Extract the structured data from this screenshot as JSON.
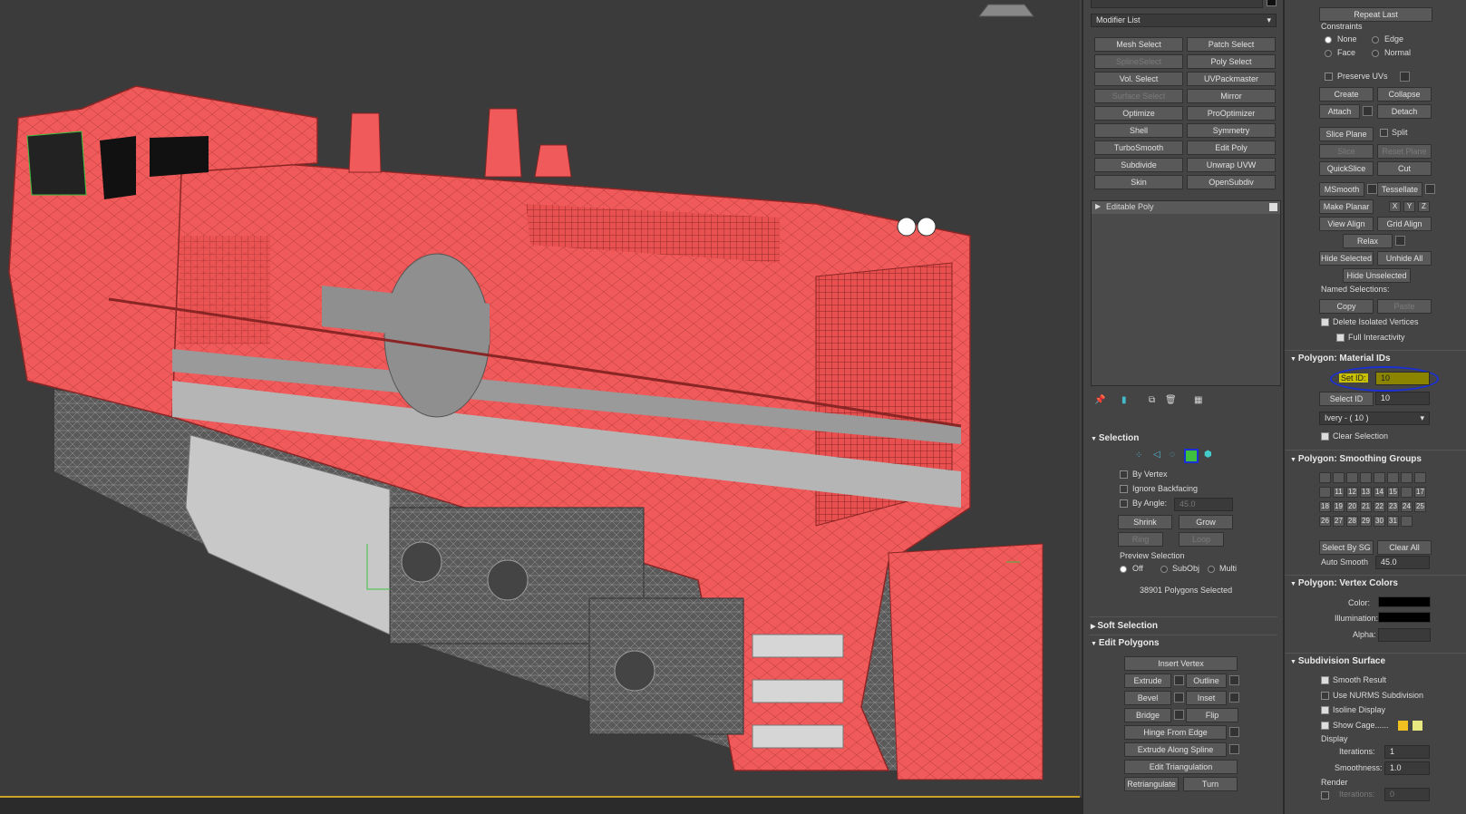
{
  "modifier_panel": {
    "object_name": "",
    "modifier_list": "Modifier List",
    "buttons": [
      {
        "label": "Mesh Select",
        "enabled": true
      },
      {
        "label": "Patch Select",
        "enabled": true
      },
      {
        "label": "SplineSelect",
        "enabled": false
      },
      {
        "label": "Poly Select",
        "enabled": true
      },
      {
        "label": "Vol. Select",
        "enabled": true
      },
      {
        "label": "UVPackmaster",
        "enabled": true
      },
      {
        "label": "Surface Select",
        "enabled": false
      },
      {
        "label": "Mirror",
        "enabled": true
      },
      {
        "label": "Optimize",
        "enabled": true
      },
      {
        "label": "ProOptimizer",
        "enabled": true
      },
      {
        "label": "Shell",
        "enabled": true
      },
      {
        "label": "Symmetry",
        "enabled": true
      },
      {
        "label": "TurboSmooth",
        "enabled": true
      },
      {
        "label": "Edit Poly",
        "enabled": true
      },
      {
        "label": "Subdivide",
        "enabled": true
      },
      {
        "label": "Unwrap UVW",
        "enabled": true
      },
      {
        "label": "Skin",
        "enabled": true
      },
      {
        "label": "OpenSubdiv",
        "enabled": true
      }
    ],
    "stack_item": "Editable Poly"
  },
  "selection": {
    "title": "Selection",
    "by_vertex": "By Vertex",
    "ignore_backfacing": "Ignore Backfacing",
    "by_angle": "By Angle:",
    "by_angle_value": "45.0",
    "shrink": "Shrink",
    "grow": "Grow",
    "ring": "Ring",
    "loop": "Loop",
    "preview_selection": "Preview Selection",
    "preview_off": "Off",
    "preview_subobj": "SubObj",
    "preview_multi": "Multi",
    "status": "38901 Polygons Selected"
  },
  "soft_selection": {
    "title": "Soft Selection"
  },
  "edit_polygons": {
    "title": "Edit Polygons",
    "insert_vertex": "Insert Vertex",
    "extrude": "Extrude",
    "outline": "Outline",
    "bevel": "Bevel",
    "inset": "Inset",
    "bridge": "Bridge",
    "flip": "Flip",
    "hinge_from_edge": "Hinge From Edge",
    "extrude_along_spline": "Extrude Along Spline",
    "edit_triangulation": "Edit Triangulation",
    "retriangulate": "Retriangulate",
    "turn": "Turn"
  },
  "edit_geometry": {
    "repeat_last": "Repeat Last",
    "constraints": "Constraints",
    "c_none": "None",
    "c_edge": "Edge",
    "c_face": "Face",
    "c_normal": "Normal",
    "preserve_uvs": "Preserve UVs",
    "create": "Create",
    "collapse": "Collapse",
    "attach": "Attach",
    "detach": "Detach",
    "slice_plane": "Slice Plane",
    "split": "Split",
    "slice": "Slice",
    "reset_plane": "Reset Plane",
    "quickslice": "QuickSlice",
    "cut": "Cut",
    "msmooth": "MSmooth",
    "tessellate": "Tessellate",
    "make_planar": "Make Planar",
    "x": "X",
    "y": "Y",
    "z": "Z",
    "view_align": "View Align",
    "grid_align": "Grid Align",
    "relax": "Relax",
    "hide_selected": "Hide Selected",
    "unhide_all": "Unhide All",
    "hide_unselected": "Hide Unselected",
    "named_selections": "Named Selections:",
    "copy": "Copy",
    "paste": "Paste",
    "delete_isolated": "Delete Isolated Vertices",
    "full_interactivity": "Full Interactivity"
  },
  "material_ids": {
    "title": "Polygon: Material IDs",
    "set_id": "Set ID:",
    "set_id_value": "10",
    "select_id": "Select ID",
    "select_id_value": "10",
    "material_name": "Ivery - ( 10 )",
    "clear_selection": "Clear Selection"
  },
  "smoothing_groups": {
    "title": "Polygon: Smoothing Groups",
    "numbers": [
      "",
      "",
      "",
      "",
      "",
      "",
      "",
      "",
      "",
      "11",
      "12",
      "13",
      "14",
      "15",
      "",
      "17",
      "18",
      "19",
      "20",
      "21",
      "22",
      "23",
      "24",
      "25",
      "26",
      "27",
      "28",
      "29",
      "30",
      "31",
      ""
    ],
    "select_by_sg": "Select By SG",
    "clear_all": "Clear All",
    "auto_smooth": "Auto Smooth",
    "auto_smooth_value": "45.0"
  },
  "vertex_colors": {
    "title": "Polygon: Vertex Colors",
    "color": "Color:",
    "illumination": "Illumination:",
    "alpha": "Alpha:"
  },
  "subdivision_surface": {
    "title": "Subdivision Surface",
    "smooth_result": "Smooth Result",
    "use_nurms": "Use NURMS Subdivision",
    "isoline_display": "Isoline Display",
    "show_cage": "Show Cage......",
    "display": "Display",
    "iterations": "Iterations:",
    "iterations_value": "1",
    "smoothness": "Smoothness:",
    "smoothness_value": "1.0",
    "render": "Render",
    "render_iterations": "Iterations:",
    "render_iterations_value": "0"
  },
  "colors": {
    "selection_red": "#f15a5a",
    "accent_green": "#3fbf3f",
    "annotation_blue": "#1a2fd6",
    "highlight_yellow": "#c9c000",
    "cage_yellow1": "#f0c020",
    "cage_yellow2": "#e8e880"
  }
}
